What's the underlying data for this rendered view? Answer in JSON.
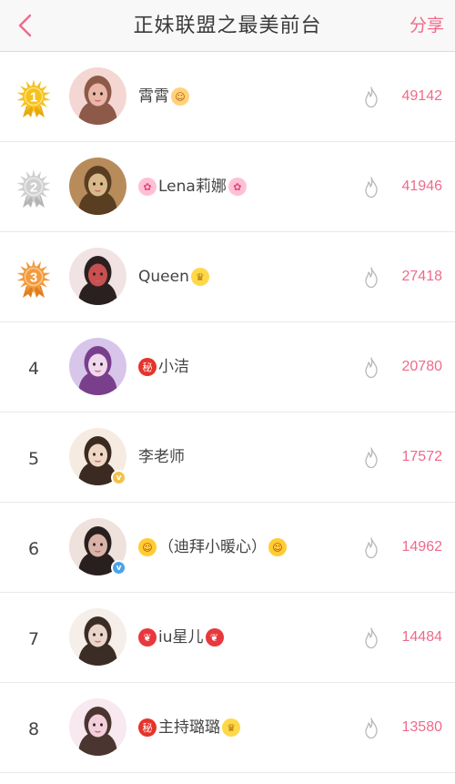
{
  "header": {
    "title": "正妹联盟之最美前台",
    "share_label": "分享",
    "accent_color": "#f06a8a"
  },
  "leaderboard": [
    {
      "rank": "1",
      "medal": "gold",
      "name": "霄霄",
      "prefix_emoji": "",
      "suffix_emoji": "girl-emoji",
      "score": "49142",
      "verified": false
    },
    {
      "rank": "2",
      "medal": "silver",
      "name": "Lena莉娜",
      "prefix_emoji": "cherry-blossom-emoji",
      "suffix_emoji": "cherry-blossom-emoji",
      "score": "41946",
      "verified": false
    },
    {
      "rank": "3",
      "medal": "bronze",
      "name": "Queen",
      "prefix_emoji": "",
      "suffix_emoji": "crown-emoji",
      "score": "27418",
      "verified": false
    },
    {
      "rank": "4",
      "medal": "",
      "name": "小洁",
      "prefix_emoji": "secret-emoji",
      "suffix_emoji": "",
      "score": "20780",
      "verified": false
    },
    {
      "rank": "5",
      "medal": "",
      "name": "李老师",
      "prefix_emoji": "",
      "suffix_emoji": "",
      "score": "17572",
      "verified": true,
      "verified_color": "#f3c24a"
    },
    {
      "rank": "6",
      "medal": "",
      "name": "（迪拜小暖心）",
      "prefix_emoji": "kiss-face-emoji",
      "suffix_emoji": "kiss-face-emoji",
      "score": "14962",
      "verified": true,
      "verified_color": "#4aa3e8"
    },
    {
      "rank": "7",
      "medal": "",
      "name": "iu星儿",
      "prefix_emoji": "strawberry-emoji",
      "suffix_emoji": "strawberry-emoji",
      "score": "14484",
      "verified": false
    },
    {
      "rank": "8",
      "medal": "",
      "name": "主持璐璐",
      "prefix_emoji": "secret-emoji",
      "suffix_emoji": "crown-emoji",
      "score": "13580",
      "verified": false
    }
  ]
}
